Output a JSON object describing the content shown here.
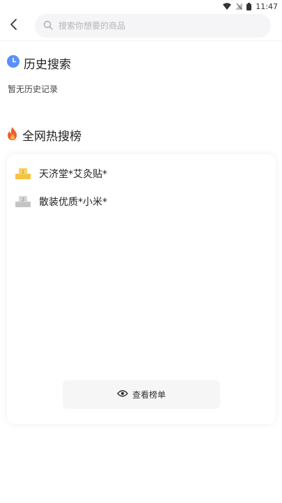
{
  "status_bar": {
    "time": "11:47",
    "icons": [
      "wifi-icon",
      "signal-off-icon",
      "battery-icon"
    ]
  },
  "header": {
    "back_icon": "chevron-left-icon",
    "search": {
      "icon": "search-icon",
      "placeholder": "搜索你想要的商品",
      "value": ""
    }
  },
  "history": {
    "icon": "clock-icon",
    "title": "历史搜索",
    "empty_text": "暂无历史记录",
    "accent": "#5b8ff9"
  },
  "hot": {
    "icon": "fire-icon",
    "title": "全网热搜榜",
    "items": [
      {
        "rank": 1,
        "icon": "rank-1-gold-icon",
        "label": "天济堂*艾灸贴*",
        "color": "#f5c342"
      },
      {
        "rank": 2,
        "icon": "rank-2-silver-icon",
        "label": "散装优质*小米*",
        "color": "#bdbdbd"
      }
    ],
    "view_button": {
      "icon": "eye-icon",
      "label": "查看榜单"
    }
  }
}
